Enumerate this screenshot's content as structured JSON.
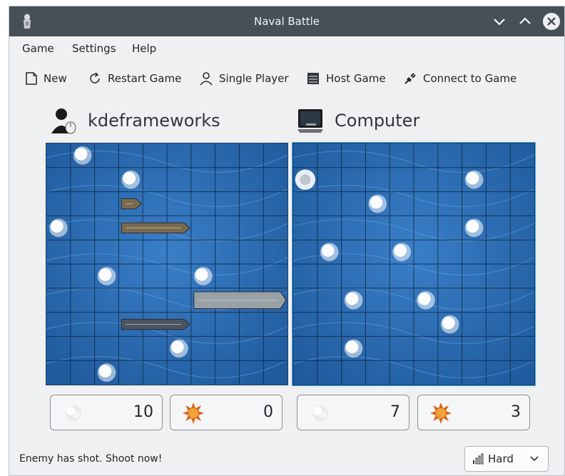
{
  "window": {
    "title": "Naval Battle"
  },
  "menu": {
    "items": [
      "Game",
      "Settings",
      "Help"
    ]
  },
  "toolbar": {
    "new_label": "New",
    "restart_label": "Restart Game",
    "single_label": "Single Player",
    "host_label": "Host Game",
    "connect_label": "Connect to Game"
  },
  "players": {
    "left": {
      "name": "kdeframeworks",
      "misses": "10",
      "hits": "0"
    },
    "right": {
      "name": "Computer",
      "misses": "7",
      "hits": "3"
    }
  },
  "status": {
    "message": "Enemy has shot. Shoot now!"
  },
  "difficulty": {
    "selected": "Hard"
  },
  "colors": {
    "water": "#1f5a9c",
    "grid": "#0c2238",
    "titlebar": "#475057",
    "accent": "#3daee9",
    "hit": "#e07b1d"
  },
  "icons": {
    "new": "document-new-icon",
    "restart": "restart-icon",
    "single": "user-icon",
    "host": "server-icon",
    "connect": "plug-icon",
    "miss": "splash-icon",
    "hit": "explosion-icon"
  },
  "boards": {
    "left": {
      "misses": [
        [
          0,
          1
        ],
        [
          1,
          3
        ],
        [
          3,
          0
        ],
        [
          5,
          6
        ],
        [
          8,
          5
        ],
        [
          9,
          2
        ],
        [
          5,
          2
        ]
      ],
      "hits": [],
      "ships": [
        {
          "row": 3,
          "col": 3,
          "length": 3,
          "orientation": "horizontal",
          "kind": "destroyer"
        },
        {
          "row": 6,
          "col": 6,
          "length": 4,
          "orientation": "horizontal",
          "kind": "carrier"
        },
        {
          "row": 7,
          "col": 3,
          "length": 3,
          "orientation": "horizontal",
          "kind": "wrecked"
        },
        {
          "row": 2,
          "col": 3,
          "length": 1,
          "orientation": "horizontal",
          "kind": "small"
        }
      ]
    },
    "right": {
      "misses": [
        [
          1,
          7
        ],
        [
          3,
          7
        ],
        [
          4,
          1
        ],
        [
          4,
          4
        ],
        [
          6,
          2
        ],
        [
          6,
          5
        ],
        [
          7,
          6
        ],
        [
          8,
          2
        ],
        [
          2,
          3
        ]
      ],
      "hits": [
        [
          1,
          0
        ]
      ],
      "ships": []
    }
  }
}
